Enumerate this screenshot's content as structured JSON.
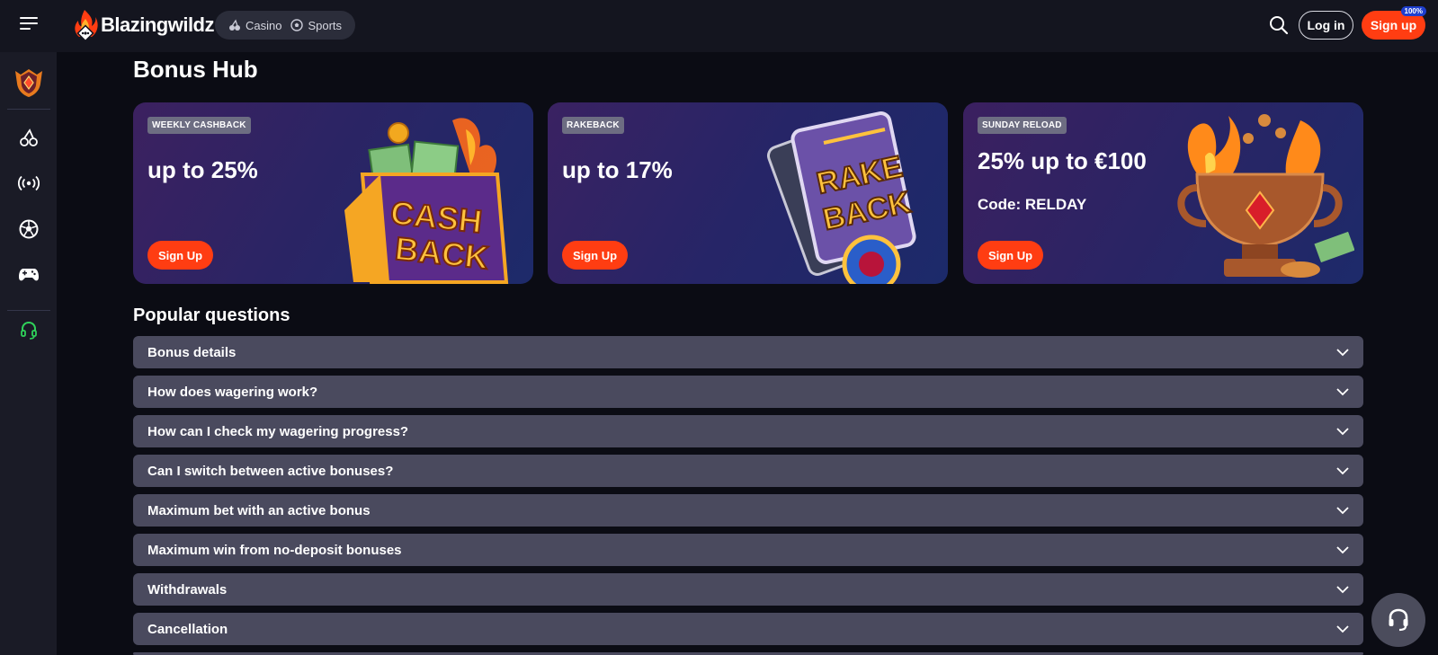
{
  "header": {
    "logo_text": "Blazingwildz",
    "nav": [
      {
        "label": "Casino",
        "icon": "cherry-icon"
      },
      {
        "label": "Sports",
        "icon": "soccer-ball-icon"
      }
    ],
    "login_label": "Log in",
    "signup_label": "Sign up",
    "signup_badge": "100%"
  },
  "sidebar": {
    "items": [
      {
        "icon": "trophy-shield-icon"
      },
      {
        "icon": "cherry-icon"
      },
      {
        "icon": "live-broadcast-icon"
      },
      {
        "icon": "soccer-ball-icon"
      },
      {
        "icon": "gamepad-icon"
      },
      {
        "icon": "headset-support-icon"
      }
    ]
  },
  "page": {
    "title": "Bonus Hub"
  },
  "promos": [
    {
      "tag": "WEEKLY CASHBACK",
      "amount": "up to 25%",
      "code": "",
      "button": "Sign Up",
      "art": "cash-back-wallet"
    },
    {
      "tag": "RAKEBACK",
      "amount": "up to 17%",
      "code": "",
      "button": "Sign Up",
      "art": "rake-back-cards"
    },
    {
      "tag": "SUNDAY RELOAD",
      "amount": "25% up to €100",
      "code": "Code: RELDAY",
      "button": "Sign Up",
      "art": "flaming-trophy"
    }
  ],
  "faq": {
    "title": "Popular questions",
    "items": [
      "Bonus details",
      "How does wagering work?",
      "How can I check my wagering progress?",
      "Can I switch between active bonuses?",
      "Maximum bet with an active bonus",
      "Maximum win from no-deposit bonuses",
      "Withdrawals",
      "Cancellation"
    ]
  },
  "colors": {
    "accent": "#ff3d12",
    "background": "#0b0c14",
    "panel": "#1a1b26",
    "faq_bg": "#4a4a5e"
  }
}
